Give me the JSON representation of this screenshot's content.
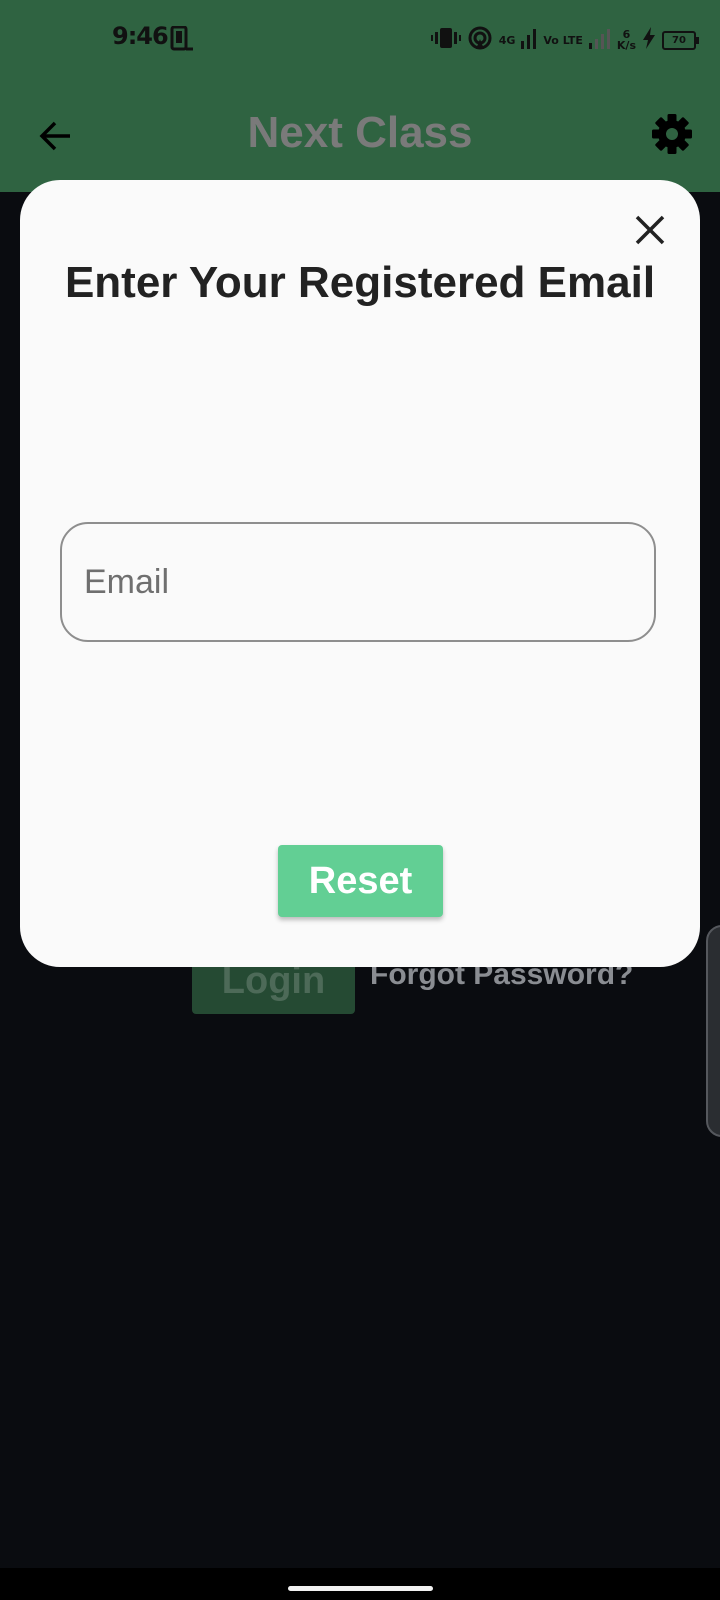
{
  "status_bar": {
    "time": "9:46",
    "network_type": "4G",
    "volte": "Vo LTE",
    "speed_value": "6",
    "speed_unit": "K/s",
    "battery": "70",
    "icons": [
      "screenshot-icon",
      "vibrate-icon",
      "hotspot-icon",
      "signal-icon",
      "charging-icon",
      "battery-icon"
    ]
  },
  "app_bar": {
    "title": "Next Class",
    "back_icon": "arrow-back-icon",
    "settings_icon": "gear-icon"
  },
  "modal": {
    "title": "Enter Your Registered Email",
    "close_icon": "close-icon",
    "email": {
      "placeholder": "Email",
      "value": ""
    },
    "reset_label": "Reset"
  },
  "background_page": {
    "login_label": "Login",
    "forgot_password_label": "Forgot Password?"
  },
  "colors": {
    "app_bar": "#2f6341",
    "page_background": "#0a0c10",
    "modal_background": "#fafafa",
    "reset_button": "#62cf94",
    "title_text": "#222222"
  }
}
